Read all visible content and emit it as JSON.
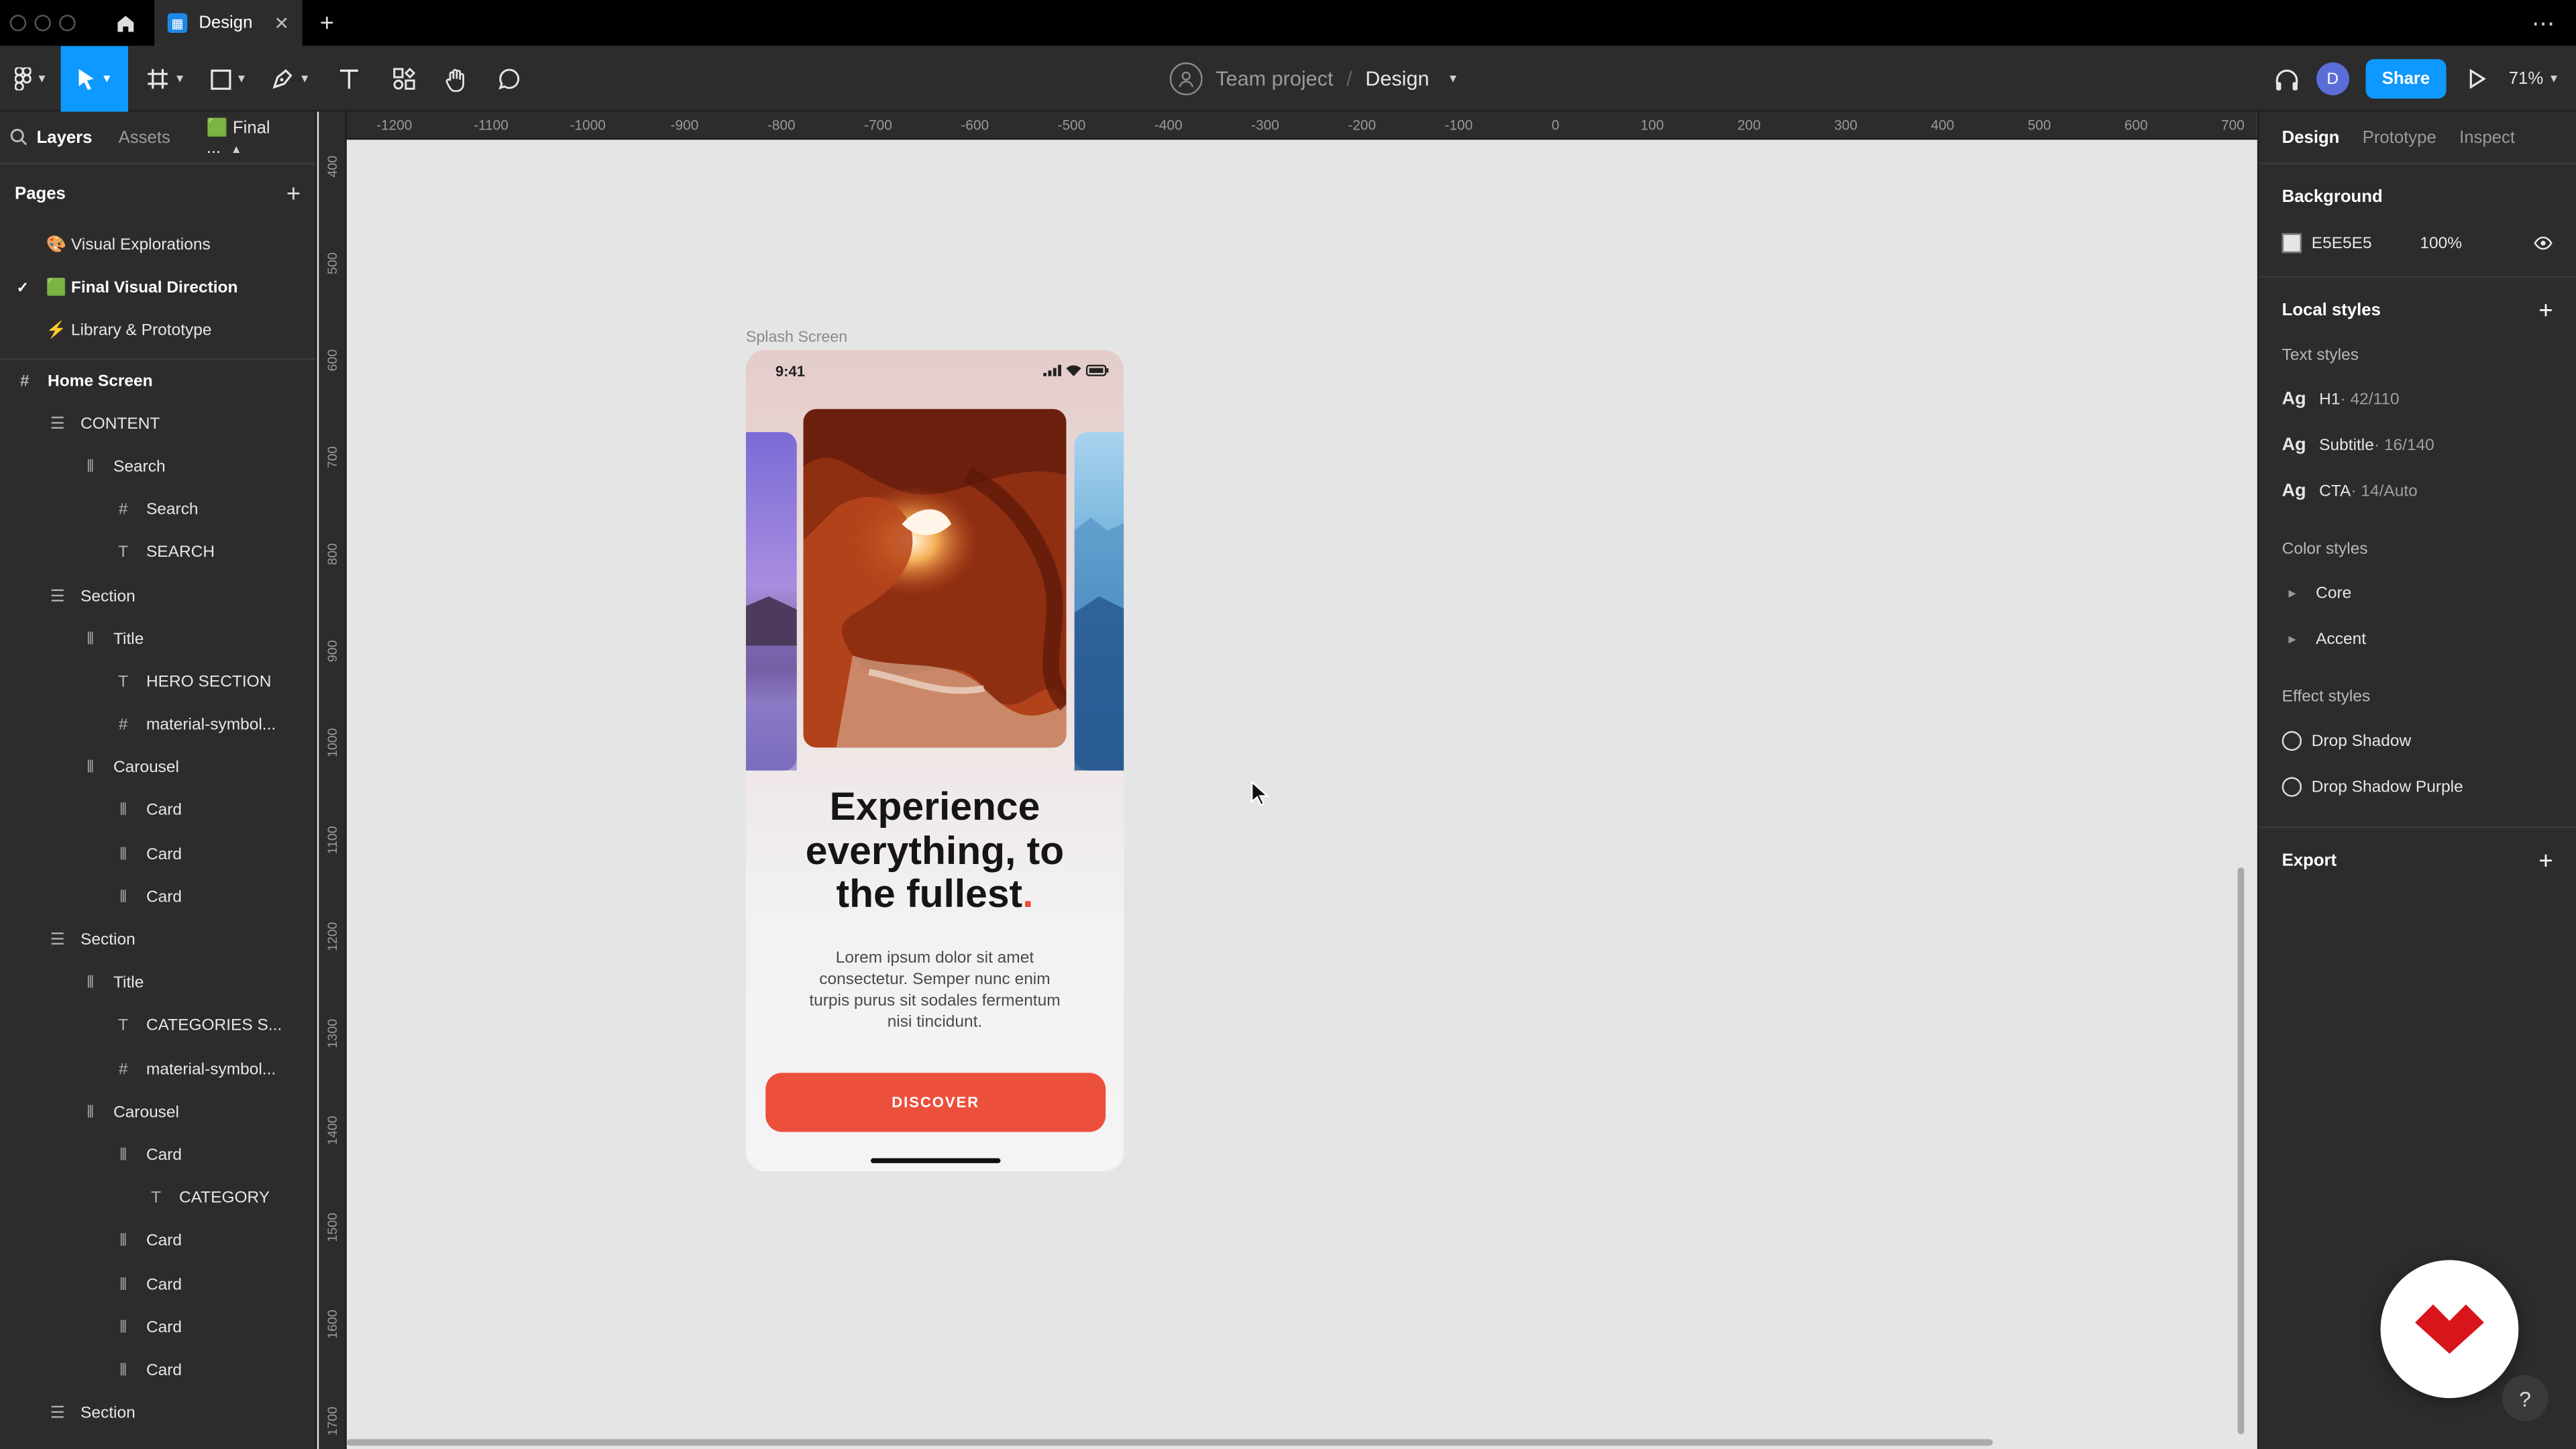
{
  "tabs": {
    "active_label": "Design"
  },
  "header": {
    "team": "Team project",
    "slash": "/",
    "file": "Design",
    "share_label": "Share",
    "zoom": "71%",
    "user_initial": "D"
  },
  "left": {
    "tab_layers": "Layers",
    "tab_assets": "Assets",
    "tab_page": "🟩 Final ...",
    "pages_title": "Pages",
    "pages": [
      {
        "label": "🎨 Visual Explorations",
        "active": false
      },
      {
        "label": "🟩 Final Visual Direction",
        "active": true
      },
      {
        "label": "⚡ Library & Prototype",
        "active": false
      }
    ],
    "layers": [
      {
        "label": "Home Screen",
        "icon": "frame-icon",
        "glyph": "#",
        "indent": 0,
        "frame": true
      },
      {
        "label": "CONTENT",
        "icon": "vertical-stack-icon",
        "glyph": "☰",
        "indent": 1
      },
      {
        "label": "Search",
        "icon": "horizontal-stack-icon",
        "glyph": "⦀",
        "indent": 2
      },
      {
        "label": "Search",
        "icon": "frame-icon",
        "glyph": "#",
        "indent": 3
      },
      {
        "label": "SEARCH",
        "icon": "text-icon",
        "glyph": "T",
        "indent": 3
      },
      {
        "label": "Section",
        "icon": "vertical-stack-icon",
        "glyph": "☰",
        "indent": 1
      },
      {
        "label": "Title",
        "icon": "horizontal-stack-icon",
        "glyph": "⦀",
        "indent": 2
      },
      {
        "label": "HERO SECTION",
        "icon": "text-icon",
        "glyph": "T",
        "indent": 3
      },
      {
        "label": "material-symbol...",
        "icon": "frame-icon",
        "glyph": "#",
        "indent": 3
      },
      {
        "label": "Carousel",
        "icon": "horizontal-stack-icon",
        "glyph": "⦀",
        "indent": 2
      },
      {
        "label": "Card",
        "icon": "horizontal-stack-icon",
        "glyph": "⦀",
        "indent": 3
      },
      {
        "label": "Card",
        "icon": "horizontal-stack-icon",
        "glyph": "⦀",
        "indent": 3
      },
      {
        "label": "Card",
        "icon": "horizontal-stack-icon",
        "glyph": "⦀",
        "indent": 3
      },
      {
        "label": "Section",
        "icon": "vertical-stack-icon",
        "glyph": "☰",
        "indent": 1
      },
      {
        "label": "Title",
        "icon": "horizontal-stack-icon",
        "glyph": "⦀",
        "indent": 2
      },
      {
        "label": "CATEGORIES S...",
        "icon": "text-icon",
        "glyph": "T",
        "indent": 3
      },
      {
        "label": "material-symbol...",
        "icon": "frame-icon",
        "glyph": "#",
        "indent": 3
      },
      {
        "label": "Carousel",
        "icon": "horizontal-stack-icon",
        "glyph": "⦀",
        "indent": 2
      },
      {
        "label": "Card",
        "icon": "horizontal-stack-icon",
        "glyph": "⦀",
        "indent": 3
      },
      {
        "label": "CATEGORY",
        "icon": "text-icon",
        "glyph": "T",
        "indent": 4
      },
      {
        "label": "Card",
        "icon": "horizontal-stack-icon",
        "glyph": "⦀",
        "indent": 3
      },
      {
        "label": "Card",
        "icon": "horizontal-stack-icon",
        "glyph": "⦀",
        "indent": 3
      },
      {
        "label": "Card",
        "icon": "horizontal-stack-icon",
        "glyph": "⦀",
        "indent": 3
      },
      {
        "label": "Card",
        "icon": "horizontal-stack-icon",
        "glyph": "⦀",
        "indent": 3
      },
      {
        "label": "Section",
        "icon": "vertical-stack-icon",
        "glyph": "☰",
        "indent": 1
      }
    ]
  },
  "canvas": {
    "ruler_h": [
      "-1200",
      "-1100",
      "-1000",
      "-900",
      "-800",
      "-700",
      "-600",
      "-500",
      "-400",
      "-300",
      "-200",
      "-100",
      "0",
      "100",
      "200",
      "300",
      "400",
      "500",
      "600",
      "700"
    ],
    "ruler_v": [
      "400",
      "500",
      "600",
      "700",
      "800",
      "900",
      "1000",
      "1100",
      "1200",
      "1300",
      "1400",
      "1500",
      "1600",
      "1700"
    ],
    "frame_label": "Splash Screen",
    "phone": {
      "time": "9:41",
      "headline_1": "Experience",
      "headline_2": "everything, to",
      "headline_3": "the fullest",
      "headline_dot": ".",
      "body": "Lorem ipsum dolor sit amet consectetur. Semper nunc enim turpis purus sit sodales fermentum nisi tincidunt.",
      "cta": "DISCOVER"
    }
  },
  "right": {
    "tab_design": "Design",
    "tab_prototype": "Prototype",
    "tab_inspect": "Inspect",
    "background_title": "Background",
    "bg_hex": "E5E5E5",
    "bg_opacity": "100%",
    "local_styles_title": "Local styles",
    "text_styles_title": "Text styles",
    "text_styles": [
      {
        "ag": "Ag",
        "name": "H1",
        "meta": " · 42/110"
      },
      {
        "ag": "Ag",
        "name": "Subtitle",
        "meta": " · 16/140"
      },
      {
        "ag": "Ag",
        "name": "CTA",
        "meta": " · 14/Auto"
      }
    ],
    "color_styles_title": "Color styles",
    "color_styles": [
      "Core",
      "Accent"
    ],
    "effect_styles_title": "Effect styles",
    "effect_styles": [
      "Drop Shadow",
      "Drop Shadow Purple"
    ],
    "export_title": "Export"
  },
  "colors": {
    "accent": "#0d99ff",
    "cta": "#ed4f3d",
    "canvas": "#e5e5e5",
    "panel": "#2c2c2c"
  }
}
